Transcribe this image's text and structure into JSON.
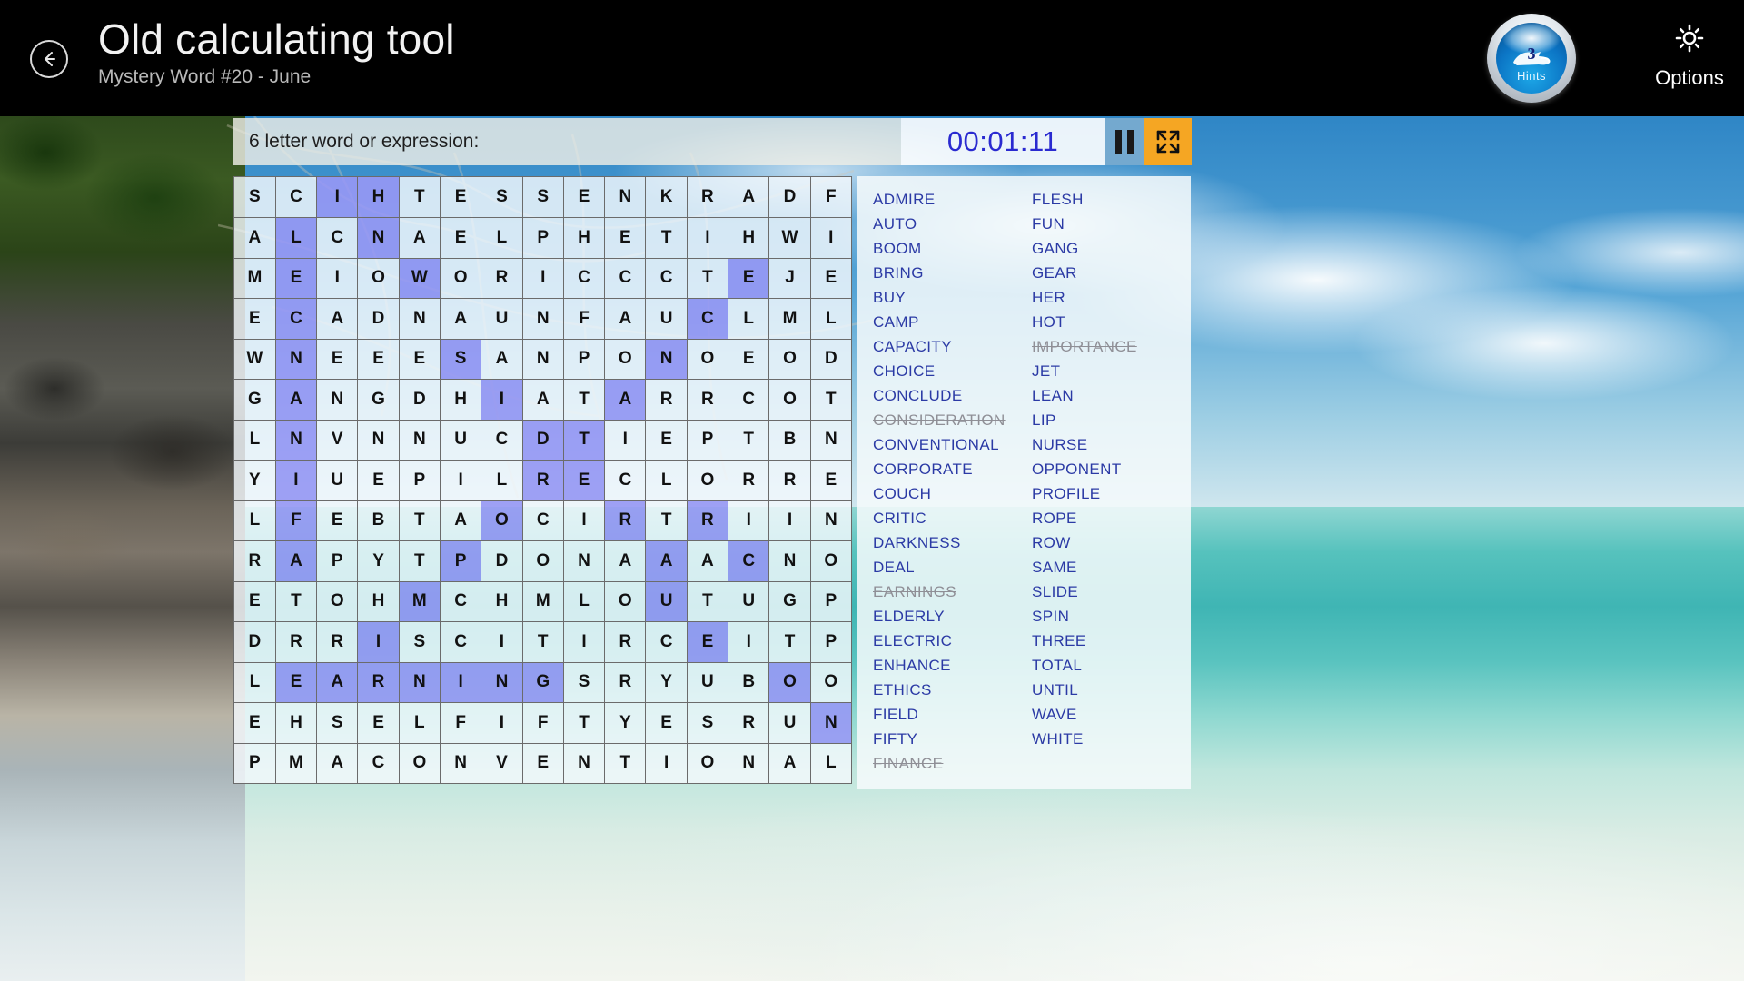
{
  "header": {
    "back_icon": "back-arrow-icon",
    "title": "Old calculating tool",
    "subtitle": "Mystery Word #20 - June",
    "hints": {
      "count": "3",
      "label": "Hints",
      "icon": "genie-lamp-icon"
    },
    "options": {
      "label": "Options",
      "icon": "gear-icon"
    }
  },
  "toolbar": {
    "prompt": "6 letter word or expression:",
    "timer": "00:01:11",
    "pause_icon": "pause-icon",
    "fullscreen_icon": "fullscreen-icon"
  },
  "grid": {
    "rows": 15,
    "cols": 15,
    "letters": [
      [
        "S",
        "C",
        "I",
        "H",
        "T",
        "E",
        "S",
        "S",
        "E",
        "N",
        "K",
        "R",
        "A",
        "D",
        "F"
      ],
      [
        "A",
        "L",
        "C",
        "N",
        "A",
        "E",
        "L",
        "P",
        "H",
        "E",
        "T",
        "I",
        "H",
        "W",
        "I"
      ],
      [
        "M",
        "E",
        "I",
        "O",
        "W",
        "O",
        "R",
        "I",
        "C",
        "C",
        "C",
        "T",
        "E",
        "J",
        "E"
      ],
      [
        "E",
        "C",
        "A",
        "D",
        "N",
        "A",
        "U",
        "N",
        "F",
        "A",
        "U",
        "C",
        "L",
        "M",
        "L"
      ],
      [
        "W",
        "N",
        "E",
        "E",
        "E",
        "S",
        "A",
        "N",
        "P",
        "O",
        "N",
        "O",
        "E",
        "O",
        "D"
      ],
      [
        "G",
        "A",
        "N",
        "G",
        "D",
        "H",
        "I",
        "A",
        "T",
        "A",
        "R",
        "R",
        "C",
        "O",
        "T"
      ],
      [
        "L",
        "N",
        "V",
        "N",
        "N",
        "U",
        "C",
        "D",
        "T",
        "I",
        "E",
        "P",
        "T",
        "B",
        "N"
      ],
      [
        "Y",
        "I",
        "U",
        "E",
        "P",
        "I",
        "L",
        "R",
        "E",
        "C",
        "L",
        "O",
        "R",
        "R",
        "E"
      ],
      [
        "L",
        "F",
        "E",
        "B",
        "T",
        "A",
        "O",
        "C",
        "I",
        "R",
        "T",
        "R",
        "I",
        "I",
        "N"
      ],
      [
        "R",
        "A",
        "P",
        "Y",
        "T",
        "P",
        "D",
        "O",
        "N",
        "A",
        "A",
        "A",
        "C",
        "N",
        "O"
      ],
      [
        "E",
        "T",
        "O",
        "H",
        "M",
        "C",
        "H",
        "M",
        "L",
        "O",
        "U",
        "T",
        "U",
        "G",
        "P"
      ],
      [
        "D",
        "R",
        "R",
        "I",
        "S",
        "C",
        "I",
        "T",
        "I",
        "R",
        "C",
        "E",
        "I",
        "T",
        "P"
      ],
      [
        "L",
        "E",
        "A",
        "R",
        "N",
        "I",
        "N",
        "G",
        "S",
        "R",
        "Y",
        "U",
        "B",
        "O",
        "O"
      ],
      [
        "E",
        "H",
        "S",
        "E",
        "L",
        "F",
        "I",
        "F",
        "T",
        "Y",
        "E",
        "S",
        "R",
        "U",
        "N"
      ],
      [
        "P",
        "M",
        "A",
        "C",
        "O",
        "N",
        "V",
        "E",
        "N",
        "T",
        "I",
        "O",
        "N",
        "A",
        "L"
      ]
    ],
    "highlights": [
      [
        0,
        2
      ],
      [
        0,
        3
      ],
      [
        1,
        1
      ],
      [
        1,
        3
      ],
      [
        2,
        1
      ],
      [
        2,
        4
      ],
      [
        2,
        12
      ],
      [
        3,
        1
      ],
      [
        3,
        11
      ],
      [
        4,
        1
      ],
      [
        4,
        5
      ],
      [
        4,
        10
      ],
      [
        5,
        1
      ],
      [
        5,
        6
      ],
      [
        5,
        9
      ],
      [
        6,
        1
      ],
      [
        6,
        7
      ],
      [
        6,
        8
      ],
      [
        7,
        1
      ],
      [
        7,
        7
      ],
      [
        7,
        8
      ],
      [
        8,
        1
      ],
      [
        8,
        6
      ],
      [
        8,
        9
      ],
      [
        8,
        11
      ],
      [
        9,
        1
      ],
      [
        9,
        5
      ],
      [
        9,
        10
      ],
      [
        9,
        12
      ],
      [
        10,
        4
      ],
      [
        10,
        10
      ],
      [
        11,
        3
      ],
      [
        11,
        11
      ],
      [
        12,
        1
      ],
      [
        12,
        2
      ],
      [
        12,
        3
      ],
      [
        12,
        4
      ],
      [
        12,
        5
      ],
      [
        12,
        6
      ],
      [
        12,
        7
      ],
      [
        12,
        13
      ],
      [
        13,
        14
      ]
    ]
  },
  "wordlist": {
    "left_column": [
      {
        "word": "ADMIRE",
        "found": false
      },
      {
        "word": "AUTO",
        "found": false
      },
      {
        "word": "BOOM",
        "found": false
      },
      {
        "word": "BRING",
        "found": false
      },
      {
        "word": "BUY",
        "found": false
      },
      {
        "word": "CAMP",
        "found": false
      },
      {
        "word": "CAPACITY",
        "found": false
      },
      {
        "word": "CHOICE",
        "found": false
      },
      {
        "word": "CONCLUDE",
        "found": false
      },
      {
        "word": "CONSIDERATION",
        "found": true
      },
      {
        "word": "CONVENTIONAL",
        "found": false
      },
      {
        "word": "CORPORATE",
        "found": false
      },
      {
        "word": "COUCH",
        "found": false
      },
      {
        "word": "CRITIC",
        "found": false
      },
      {
        "word": "DARKNESS",
        "found": false
      },
      {
        "word": "DEAL",
        "found": false
      },
      {
        "word": "EARNINGS",
        "found": true
      },
      {
        "word": "ELDERLY",
        "found": false
      },
      {
        "word": "ELECTRIC",
        "found": false
      },
      {
        "word": "ENHANCE",
        "found": false
      },
      {
        "word": "ETHICS",
        "found": false
      },
      {
        "word": "FIELD",
        "found": false
      },
      {
        "word": "FIFTY",
        "found": false
      },
      {
        "word": "FINANCE",
        "found": true
      }
    ],
    "right_column": [
      {
        "word": "FLESH",
        "found": false
      },
      {
        "word": "FUN",
        "found": false
      },
      {
        "word": "GANG",
        "found": false
      },
      {
        "word": "GEAR",
        "found": false
      },
      {
        "word": "HER",
        "found": false
      },
      {
        "word": "HOT",
        "found": false
      },
      {
        "word": "IMPORTANCE",
        "found": true
      },
      {
        "word": "JET",
        "found": false
      },
      {
        "word": "LEAN",
        "found": false
      },
      {
        "word": "LIP",
        "found": false
      },
      {
        "word": "NURSE",
        "found": false
      },
      {
        "word": "OPPONENT",
        "found": false
      },
      {
        "word": "PROFILE",
        "found": false
      },
      {
        "word": "ROPE",
        "found": false
      },
      {
        "word": "ROW",
        "found": false
      },
      {
        "word": "SAME",
        "found": false
      },
      {
        "word": "SLIDE",
        "found": false
      },
      {
        "word": "SPIN",
        "found": false
      },
      {
        "word": "THREE",
        "found": false
      },
      {
        "word": "TOTAL",
        "found": false
      },
      {
        "word": "UNTIL",
        "found": false
      },
      {
        "word": "WAVE",
        "found": false
      },
      {
        "word": "WHITE",
        "found": false
      }
    ]
  },
  "colors": {
    "highlight": "#9696f5",
    "word_text": "#2b3aa5",
    "found_text": "#8f8f96",
    "timer_text": "#2a2ad0",
    "accent_orange": "#f5a623",
    "pause_blue": "#74a9cf"
  }
}
